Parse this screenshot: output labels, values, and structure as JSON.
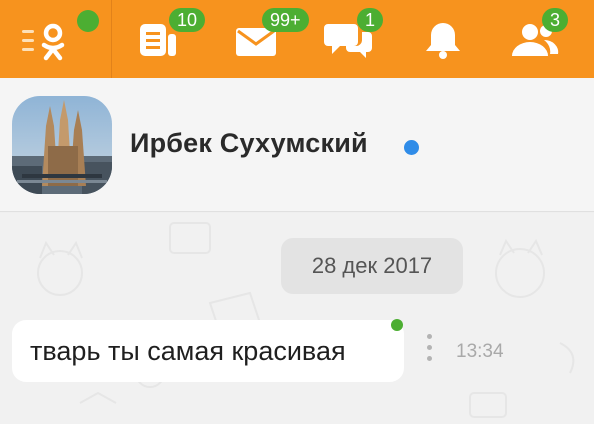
{
  "toolbar": {
    "colors": {
      "background": "#f7931e",
      "badge": "#4cae32"
    },
    "items": [
      {
        "icon": "ok-logo-menu-icon",
        "badge": null
      },
      {
        "icon": "feed-icon",
        "badge": "10"
      },
      {
        "icon": "mail-icon",
        "badge": "99+"
      },
      {
        "icon": "discussions-icon",
        "badge": "1"
      },
      {
        "icon": "bell-icon",
        "badge": null
      },
      {
        "icon": "friends-icon",
        "badge": "3"
      }
    ]
  },
  "profile": {
    "name": "Ирбек Сухумский",
    "online_color": "#2f8ce8",
    "avatar_icon": "cathedral-photo"
  },
  "chat": {
    "date": "28 дек 2017",
    "messages": [
      {
        "text": "тварь ты самая красивая",
        "time": "13:34"
      }
    ]
  }
}
